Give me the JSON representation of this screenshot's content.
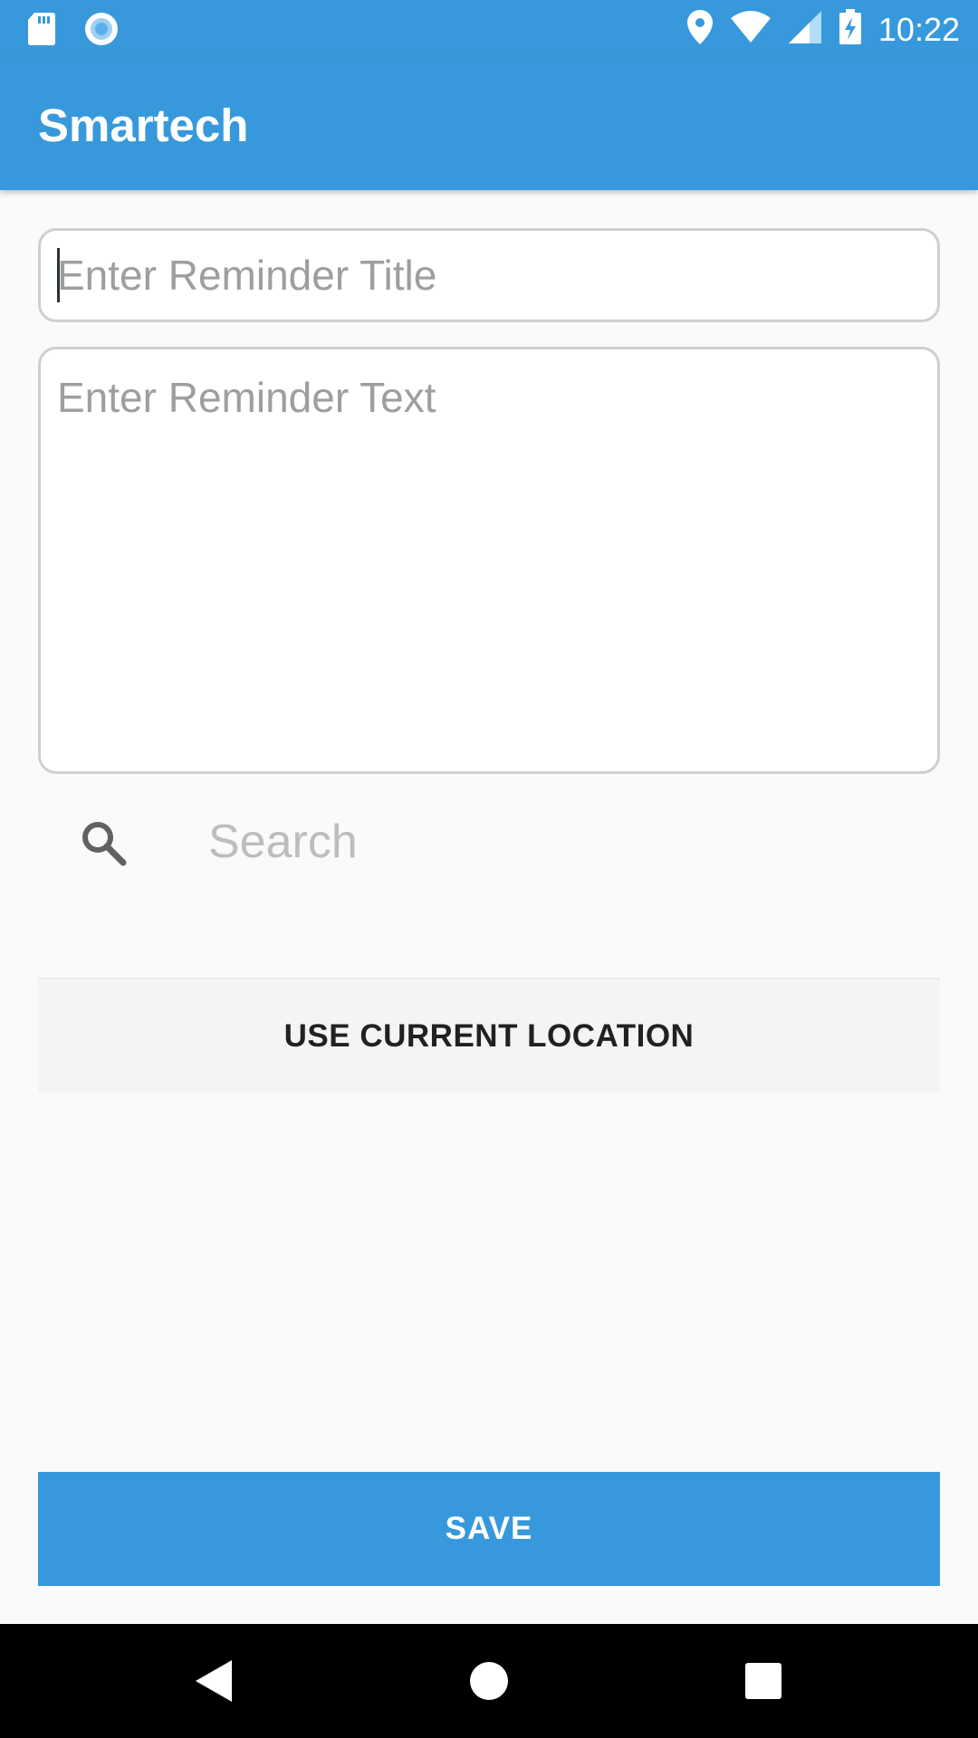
{
  "status_bar": {
    "time": "10:22",
    "left_icons": [
      "sd-card-icon",
      "record-icon"
    ],
    "right_icons": [
      "location-pin-icon",
      "wifi-icon",
      "cell-signal-icon",
      "battery-charging-icon"
    ]
  },
  "app_bar": {
    "title": "Smartech"
  },
  "form": {
    "title_placeholder": "Enter Reminder Title",
    "title_value": "",
    "text_placeholder": "Enter Reminder Text",
    "text_value": "",
    "search_placeholder": "Search",
    "search_value": ""
  },
  "buttons": {
    "use_current_location": "USE CURRENT LOCATION",
    "save": "SAVE"
  },
  "nav": {
    "items": [
      "back-icon",
      "home-icon",
      "recents-icon"
    ]
  },
  "colors": {
    "primary": "#3799db",
    "background": "#fafafa",
    "button_secondary": "#f4f4f4",
    "nav_bar": "#000000"
  }
}
